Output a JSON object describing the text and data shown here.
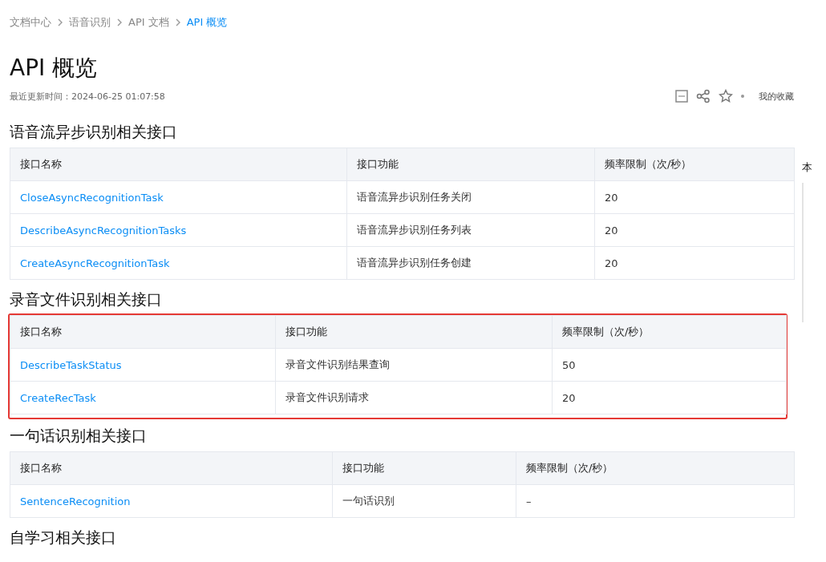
{
  "breadcrumb": [
    {
      "label": "文档中心",
      "selected": false
    },
    {
      "label": "语音识别",
      "selected": false
    },
    {
      "label": "API 文档",
      "selected": false
    },
    {
      "label": "API 概览",
      "selected": true
    }
  ],
  "title": "API 概览",
  "updated": "最近更新时间：2024-06-25 01:07:58",
  "toolbar": {
    "favorite": "我的收藏"
  },
  "sections": [
    {
      "heading": "语音流异步识别相关接口",
      "columns": [
        "接口名称",
        "接口功能",
        "频率限制（次/秒）"
      ],
      "rows": [
        [
          "CloseAsyncRecognitionTask",
          "语音流异步识别任务关闭",
          "20"
        ],
        [
          "DescribeAsyncRecognitionTasks",
          "语音流异步识别任务列表",
          "20"
        ],
        [
          "CreateAsyncRecognitionTask",
          "语音流异步识别任务创建",
          "20"
        ]
      ]
    },
    {
      "heading": "录音文件识别相关接口",
      "highlighted": true,
      "columns": [
        "接口名称",
        "接口功能",
        "频率限制（次/秒）"
      ],
      "rows": [
        [
          "DescribeTaskStatus",
          "录音文件识别结果查询",
          "50"
        ],
        [
          "CreateRecTask",
          "录音文件识别请求",
          "20"
        ]
      ]
    },
    {
      "heading": "一句话识别相关接口",
      "columns": [
        "接口名称",
        "接口功能",
        "频率限制（次/秒）"
      ],
      "rows": [
        [
          "SentenceRecognition",
          "一句话识别",
          "–"
        ]
      ]
    },
    {
      "heading": "自学习相关接口"
    }
  ],
  "toc": {
    "title": "本"
  }
}
